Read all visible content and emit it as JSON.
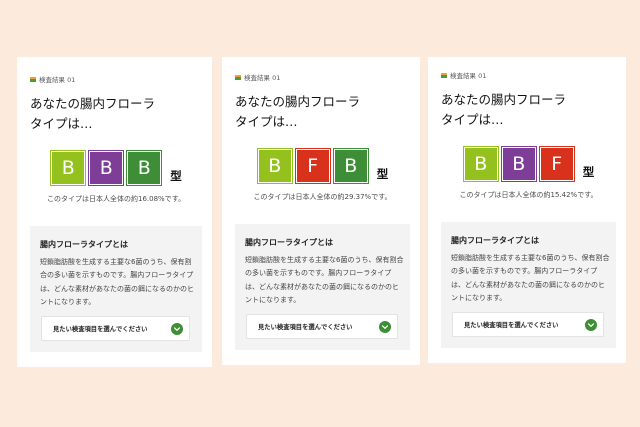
{
  "colors": {
    "page_background": "#fcebdc",
    "card_background": "#ffffff",
    "panel_background": "#f3f3f3",
    "accent_green": "#3d8e36"
  },
  "icons": {
    "label_marker": "result-marker-icon",
    "select_chevron": "chevron-down-circle-icon"
  },
  "cards": [
    {
      "label": "検査結果 01",
      "heading_lines": [
        "あなたの腸内フローラ",
        "タイプは…"
      ],
      "types": [
        {
          "letter": "B",
          "color": "#95c11f"
        },
        {
          "letter": "B",
          "color": "#7e3e98"
        },
        {
          "letter": "B",
          "color": "#3d8e36"
        }
      ],
      "type_suffix": "型",
      "share_text": "このタイプは日本人全体の約16.08%です。",
      "info": {
        "title": "腸内フローラタイプとは",
        "description": "短鎖脂肪酸を生成する主要な6菌のうち、保有割合の多い菌を示すものです。腸内フローラタイプは、どんな素材があなたの菌の餌になるのかのヒントになります。",
        "select_placeholder": "見たい検査項目を選んでください"
      }
    },
    {
      "label": "検査結果 01",
      "heading_lines": [
        "あなたの腸内フローラ",
        "タイプは…"
      ],
      "types": [
        {
          "letter": "B",
          "color": "#95c11f"
        },
        {
          "letter": "F",
          "color": "#d8311c"
        },
        {
          "letter": "B",
          "color": "#3d8e36"
        }
      ],
      "type_suffix": "型",
      "share_text": "このタイプは日本人全体の約29.37%です。",
      "info": {
        "title": "腸内フローラタイプとは",
        "description": "短鎖脂肪酸を生成する主要な6菌のうち、保有割合の多い菌を示すものです。腸内フローラタイプは、どんな素材があなたの菌の餌になるのかのヒントになります。",
        "select_placeholder": "見たい検査項目を選んでください"
      }
    },
    {
      "label": "検査結果 01",
      "heading_lines": [
        "あなたの腸内フローラ",
        "タイプは…"
      ],
      "types": [
        {
          "letter": "B",
          "color": "#95c11f"
        },
        {
          "letter": "B",
          "color": "#7e3e98"
        },
        {
          "letter": "F",
          "color": "#d8311c"
        }
      ],
      "type_suffix": "型",
      "share_text": "このタイプは日本人全体の約15.42%です。",
      "info": {
        "title": "腸内フローラタイプとは",
        "description": "短鎖脂肪酸を生成する主要な6菌のうち、保有割合の多い菌を示すものです。腸内フローラタイプは、どんな素材があなたの菌の餌になるのかのヒントになります。",
        "select_placeholder": "見たい検査項目を選んでください"
      }
    }
  ]
}
